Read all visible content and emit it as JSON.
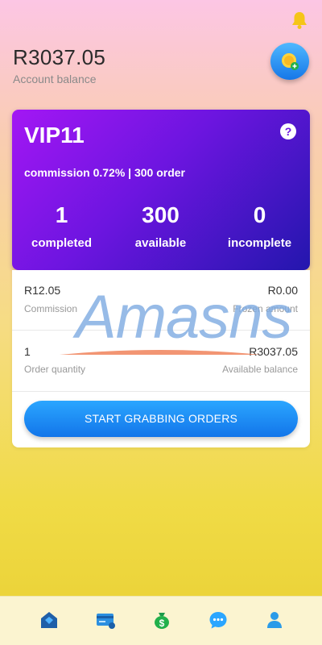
{
  "header": {
    "balance_amount": "R3037.05",
    "balance_label": "Account balance"
  },
  "vip_card": {
    "title": "VIP11",
    "subtitle": "commission 0.72% | 300 order",
    "stats": [
      {
        "value": "1",
        "label": "completed"
      },
      {
        "value": "300",
        "label": "available"
      },
      {
        "value": "0",
        "label": "incomplete"
      }
    ]
  },
  "summary": {
    "commission_value": "R12.05",
    "commission_label": "Commission",
    "frozen_value": "R0.00",
    "frozen_label": "Frozen amount",
    "order_quantity_value": "1",
    "order_quantity_label": "Order quantity",
    "available_balance_value": "R3037.05",
    "available_balance_label": "Available balance"
  },
  "start_button_label": "START GRABBING ORDERS",
  "watermark": "Amasns",
  "icons": {
    "bell": "bell-icon",
    "coin": "coin-add-icon",
    "help": "question-icon",
    "nav": [
      "home-icon",
      "wallet-card-icon",
      "money-bag-icon",
      "chat-icon",
      "user-icon"
    ]
  },
  "colors": {
    "accent_blue": "#1677e8",
    "vip_gradient_start": "#a317f4",
    "vip_gradient_end": "#2316ad",
    "bell_yellow": "#f5c518"
  }
}
